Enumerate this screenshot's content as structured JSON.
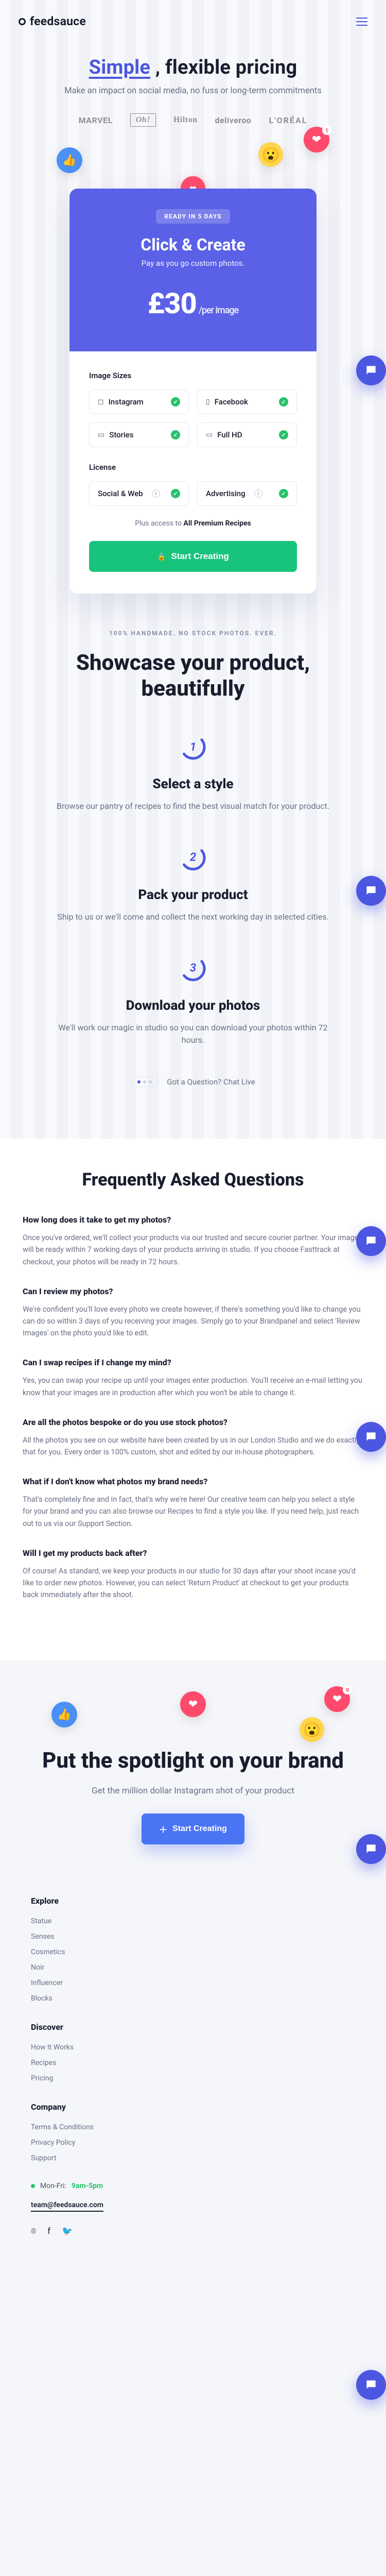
{
  "brand": "feedsauce",
  "hero": {
    "title_pre": "Simple",
    "title_post": ", flexible pricing",
    "subtitle": "Make an impact on social media, no fuss or long-term commitments"
  },
  "brand_logos": [
    "MARVEL",
    "Oh!",
    "Hilton",
    "deliveroo",
    "L'ORÉAL"
  ],
  "emojis": {
    "heart_count": "1"
  },
  "card": {
    "badge": "READY IN 5 DAYS",
    "title": "Click & Create",
    "subtitle": "Pay as you go custom photos.",
    "price": "£30",
    "per": "/per image",
    "sizes_label": "Image Sizes",
    "license_label": "License",
    "size_opts": [
      {
        "icon": "◻",
        "label": "Instagram"
      },
      {
        "icon": "▯",
        "label": "Facebook"
      },
      {
        "icon": "▭",
        "label": "Stories"
      },
      {
        "icon": "▭",
        "label": "Full HD"
      }
    ],
    "license_opts": [
      {
        "label": "Social & Web"
      },
      {
        "label": "Advertising"
      }
    ],
    "plus_pre": "Plus access to ",
    "plus_bold": "All Premium Recipes",
    "cta": "Start Creating"
  },
  "showcase": {
    "tagline": "100% HANDMADE. NO STOCK PHOTOS. EVER.",
    "title": "Showcase your product, beautifully",
    "steps": [
      {
        "n": "1",
        "h": "Select a style",
        "p": "Browse our pantry of recipes to find the best visual match for your product."
      },
      {
        "n": "2",
        "h": "Pack your product",
        "p": "Ship to us or we'll come and collect the next working day in selected cities."
      },
      {
        "n": "3",
        "h": "Download your photos",
        "p": "We'll work our magic in studio so you can download your photos within 72 hours."
      }
    ],
    "chat": "Got a Question? Chat Live"
  },
  "faq": {
    "title": "Frequently Asked Questions",
    "items": [
      {
        "q": "How long does it take to get my photos?",
        "a": "Once you've ordered, we'll collect your products via our trusted and secure courier partner. Your images will be ready within 7 working days of your products arriving in studio. If you choose Fasttrack at checkout, your photos will be ready in 72 hours."
      },
      {
        "q": "Can I review my photos?",
        "a": "We're confident you'll love every photo we create however, if there's something you'd like to change you can do so within 3 days of you receiving your images. Simply go to your Brandpanel and select 'Review Images' on the photo you'd like to edit."
      },
      {
        "q": "Can I swap recipes if I change my mind?",
        "a": "Yes, you can swap your recipe up until your images enter production. You'll receive an e-mail letting you know that your images are in production after which you won't be able to change it."
      },
      {
        "q": "Are all the photos bespoke or do you use stock photos?",
        "a": "All the photos you see on our website have been created by us in our London Studio and we do exactly that for you. Every order is 100% custom, shot and edited by our in-house photographers."
      },
      {
        "q": "What if I don't know what photos my brand needs?",
        "a": "That's completely fine and in fact, that's why we're here! Our creative team can help you select a style for your brand and you can also browse our Recipes to find a style you like. If you need help, just reach out to us via our Support Section."
      },
      {
        "q": "Will I get my products back after?",
        "a": "Of course! As standard, we keep your products in our studio for 30 days after your shoot incase you'd like to order new photos. However, you can select 'Return Product' at checkout to get your products back immediately after the shoot."
      }
    ]
  },
  "spotlight": {
    "title": "Put the spotlight on your brand",
    "lead": "Get the million dollar Instagram shot of your product",
    "cta": "Start Creating",
    "heart_count": "9"
  },
  "footer": {
    "cols": [
      {
        "h": "Explore",
        "links": [
          "Statue",
          "Senses",
          "Cosmetics",
          "Noir",
          "Influencer",
          "Blocks"
        ]
      },
      {
        "h": "Discover",
        "links": [
          "How It Works",
          "Recipes",
          "Pricing"
        ]
      },
      {
        "h": "Company",
        "links": [
          "Terms & Conditions",
          "Privacy Policy",
          "Support"
        ]
      }
    ],
    "hours_label": "Mon-Fri:",
    "hours_value": "9am-5pm",
    "email": "team@feedsauce.com"
  }
}
